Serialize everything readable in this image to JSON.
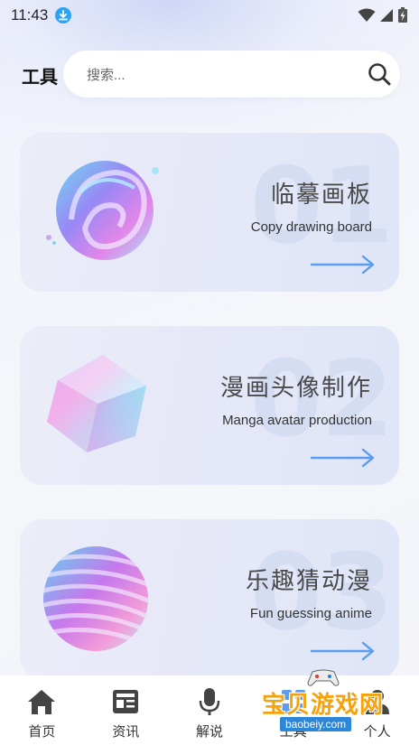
{
  "status_bar": {
    "time": "11:43",
    "icons": [
      "download-icon",
      "wifi-icon",
      "signal-icon",
      "battery-charging-icon"
    ]
  },
  "header": {
    "title": "工具",
    "search_placeholder": "搜索...",
    "search_icon": "search-icon"
  },
  "cards": [
    {
      "number": "01",
      "title": "临摹画板",
      "subtitle": "Copy drawing board",
      "art": "swirl-3d-shape",
      "arrow": "arrow-right-icon"
    },
    {
      "number": "02",
      "title": "漫画头像制作",
      "subtitle": "Manga avatar production",
      "art": "iridescent-cube",
      "arrow": "arrow-right-icon"
    },
    {
      "number": "03",
      "title": "乐趣猜动漫",
      "subtitle": "Fun guessing anime",
      "art": "striped-sphere",
      "arrow": "arrow-right-icon"
    }
  ],
  "bottom_nav": [
    {
      "label": "首页",
      "icon": "home-icon"
    },
    {
      "label": "资讯",
      "icon": "news-icon"
    },
    {
      "label": "解说",
      "icon": "microphone-icon"
    },
    {
      "label": "工具",
      "icon": "tools-icon"
    },
    {
      "label": "个人",
      "icon": "person-icon"
    }
  ],
  "watermark": {
    "text": "宝贝游戏网",
    "url": "baobeiy.com"
  },
  "colors": {
    "accent_blue": "#5a9cf0",
    "card_bg": "#e6e8f8",
    "number_faint": "#d5ddf2",
    "download_badge": "#2fa3f3",
    "watermark_orange": "#f5a20c"
  }
}
